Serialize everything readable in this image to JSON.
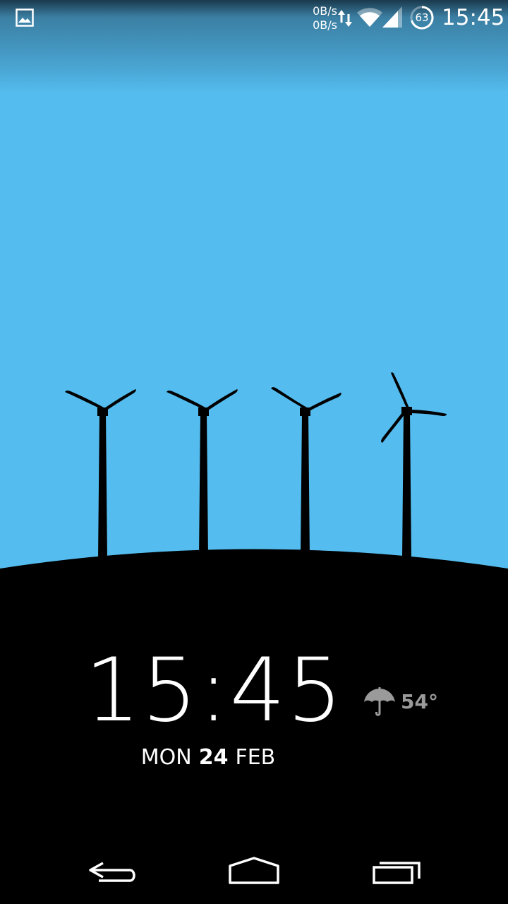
{
  "status_bar": {
    "net_speed_up": "0B/s",
    "net_speed_down": "0B/s",
    "battery_level": "63",
    "time": "15:45",
    "icons": [
      "image-notification-icon",
      "data-transfer-arrows-icon",
      "wifi-icon",
      "cell-signal-icon",
      "battery-ring-icon"
    ]
  },
  "lockscreen": {
    "clock": "15:45",
    "date": {
      "weekday": "MON",
      "day": "24",
      "month": "FEB"
    },
    "weather": {
      "icon": "umbrella-icon",
      "temperature": "54°"
    }
  },
  "wallpaper": {
    "description_icon": "wind-turbines",
    "sky_color": "#54BCEE",
    "sky_top_color": "#3F8FB6",
    "ground_color": "#000000"
  },
  "nav_bar": {
    "buttons": [
      "back-icon",
      "home-icon",
      "recents-icon"
    ]
  }
}
